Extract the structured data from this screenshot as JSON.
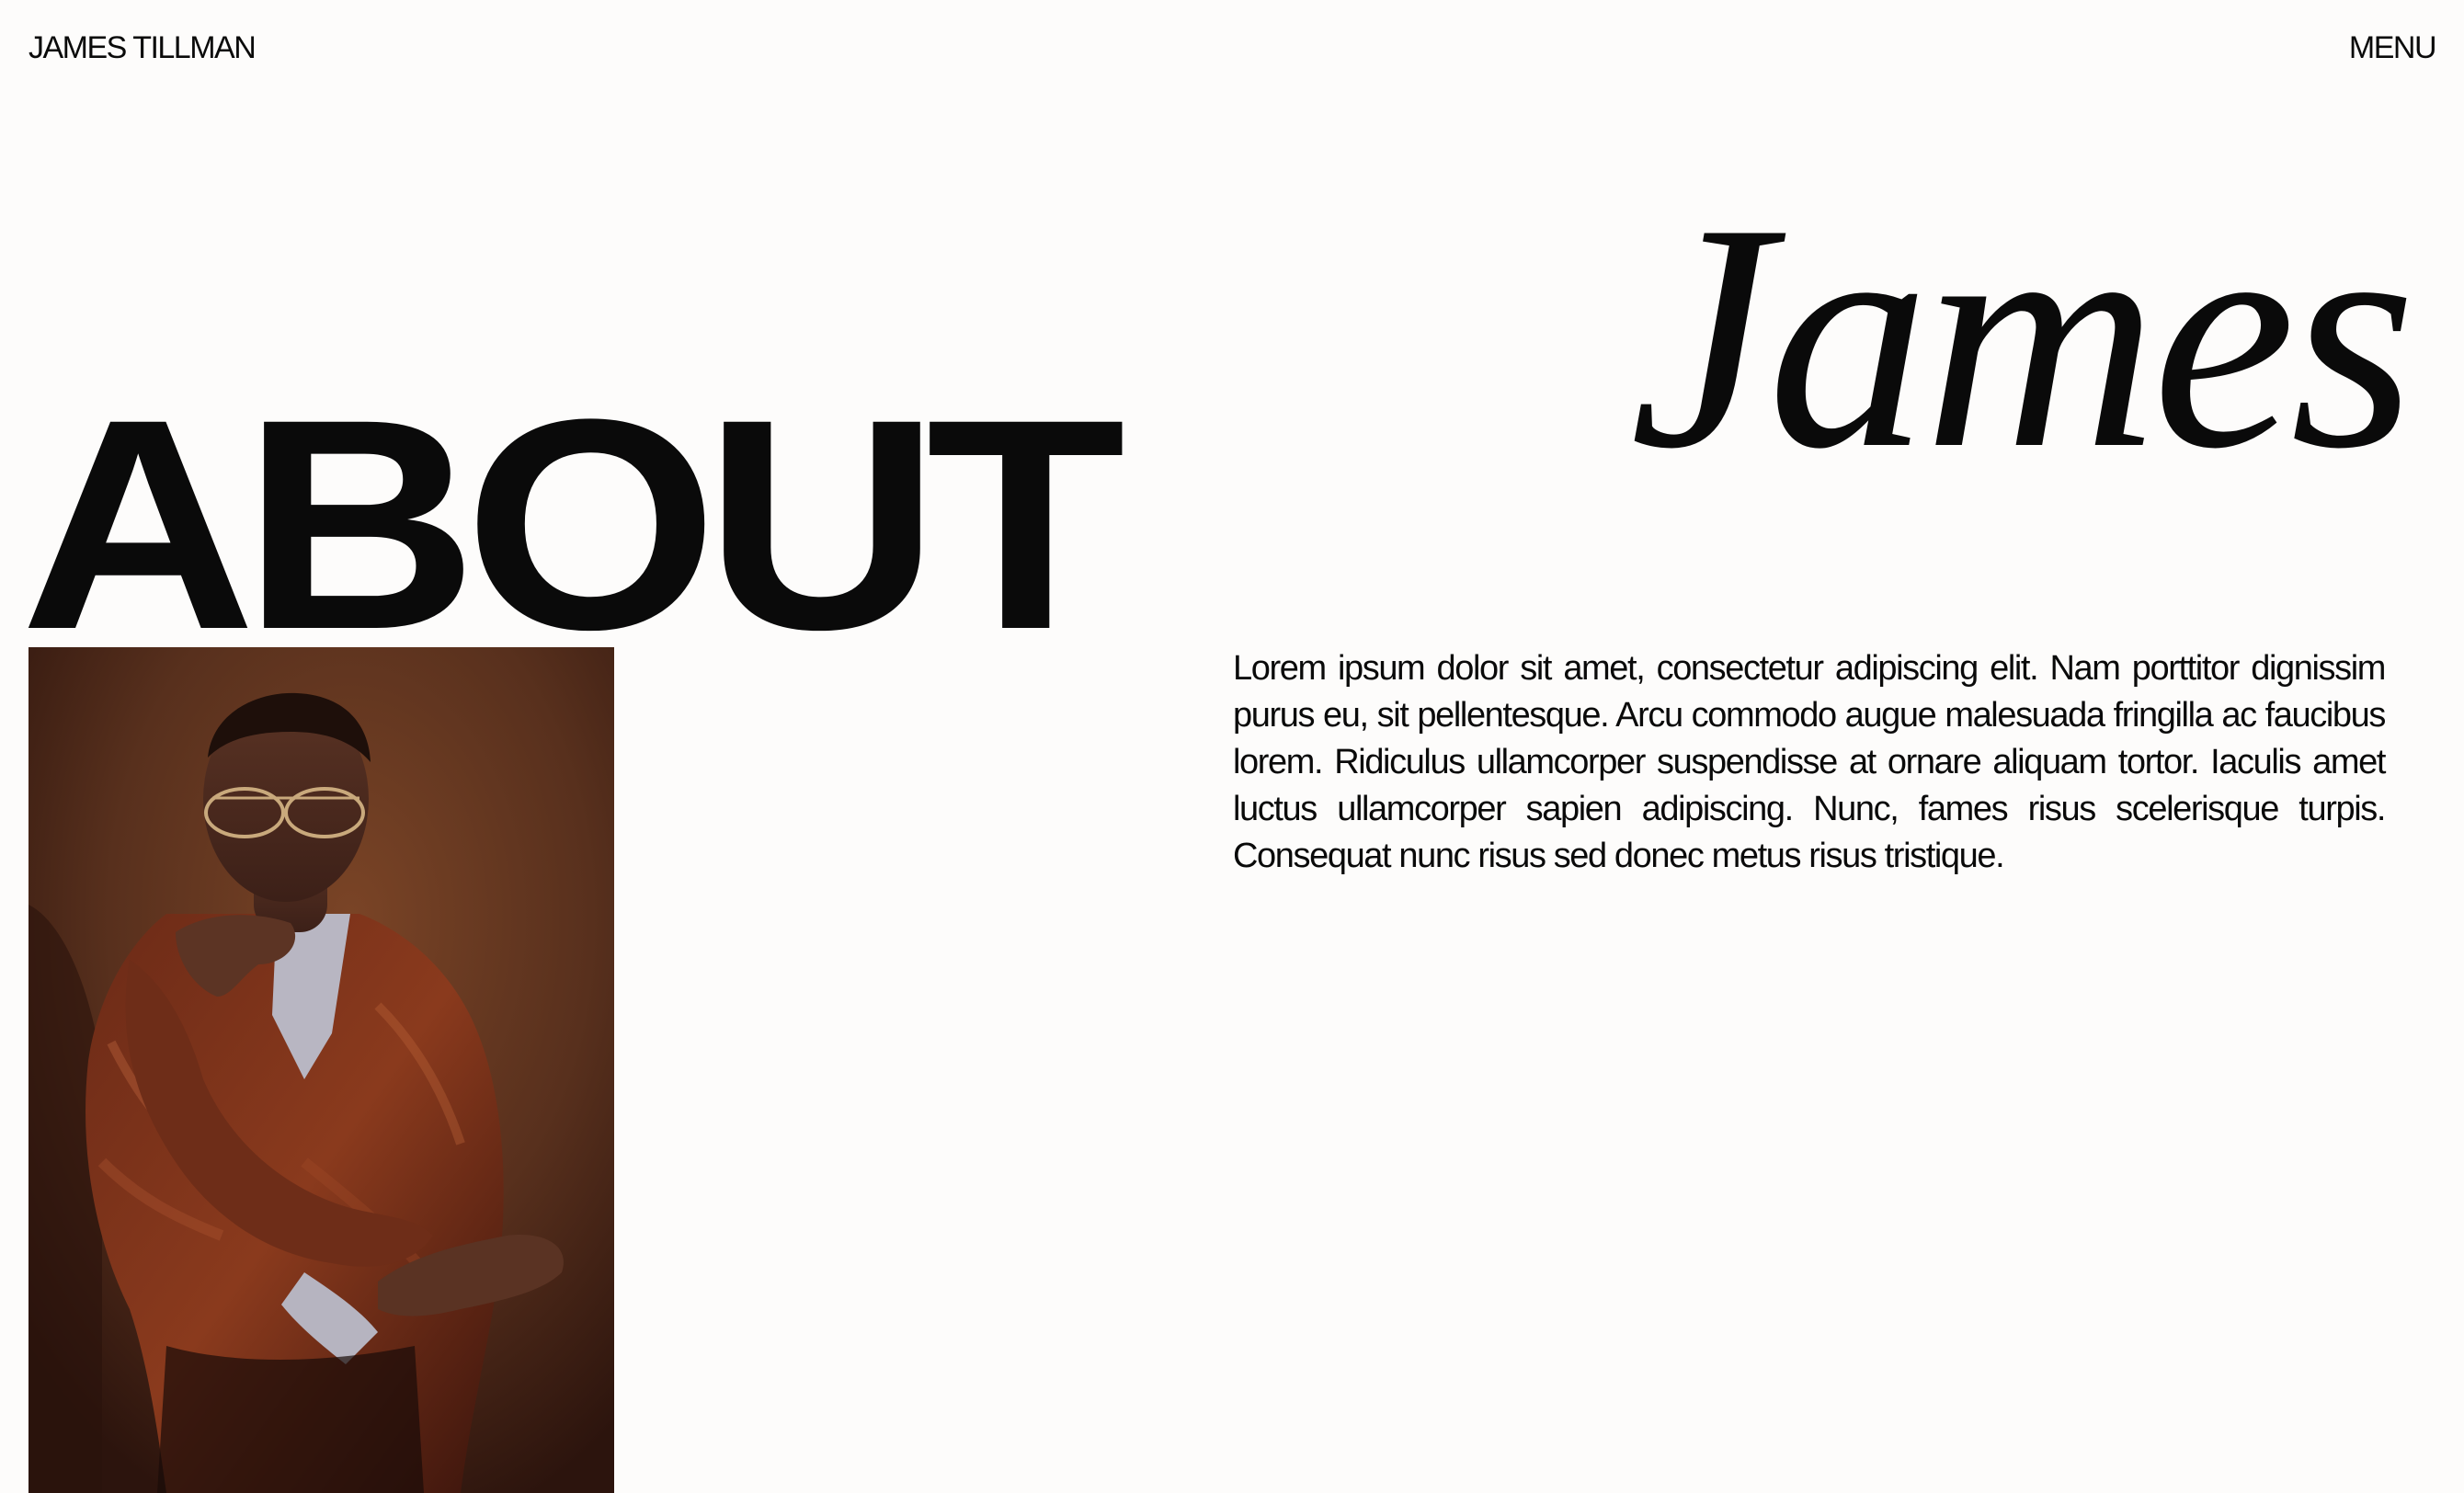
{
  "header": {
    "site_title": "JAMES TILLMAN",
    "menu_label": "MENU"
  },
  "hero": {
    "title_bold": "ABOUT",
    "title_italic": "James"
  },
  "portrait": {
    "icon": "portrait-photo"
  },
  "bio": {
    "text": "Lorem ipsum dolor sit amet, consectetur adipiscing elit. Nam porttitor dignissim purus eu, sit pellentesque. Arcu commodo augue malesuada fringilla ac faucibus lorem. Ridiculus ullamcorper suspendisse at ornare aliquam tortor. Iaculis amet luctus ullamcorper sapien adipiscing. Nunc, fames risus scelerisque turpis. Consequat nunc risus sed donec metus risus tristique."
  },
  "colors": {
    "background": "#fdfcfb",
    "text": "#0a0a0a",
    "photo_tone": "#4a2218"
  }
}
